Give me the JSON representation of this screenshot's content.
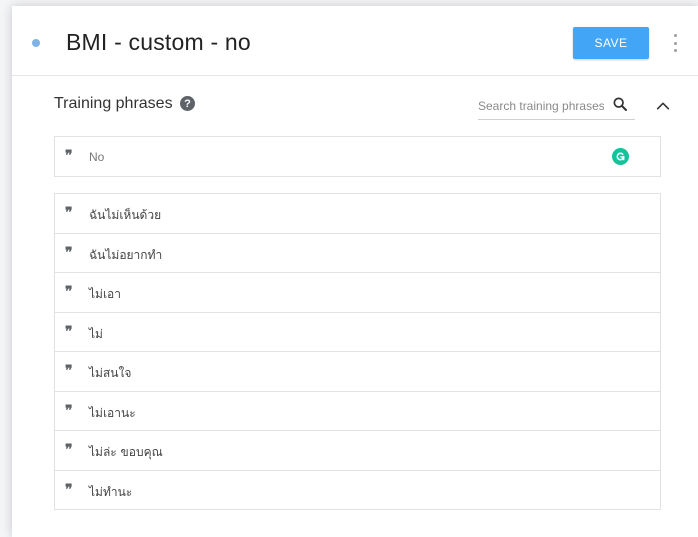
{
  "header": {
    "title": "BMI - custom - no",
    "save_label": "SAVE",
    "colors": {
      "save_bg": "#42a5f5",
      "dot": "#7fb2e5"
    }
  },
  "training": {
    "title": "Training phrases",
    "help_icon": "help-circle-icon",
    "search_placeholder": "Search training phrases",
    "search_value": "",
    "new_phrase_value": "",
    "new_phrase_placeholder": "No",
    "quote_glyph": "❞",
    "phrases": [
      "ฉันไม่เห็นด้วย",
      "ฉันไม่อยากทำ",
      "ไม่เอา",
      "ไม่",
      "ไม่สนใจ",
      "ไม่เอานะ",
      "ไม่ล่ะ ขอบคุณ",
      "ไม่ทำนะ"
    ]
  }
}
